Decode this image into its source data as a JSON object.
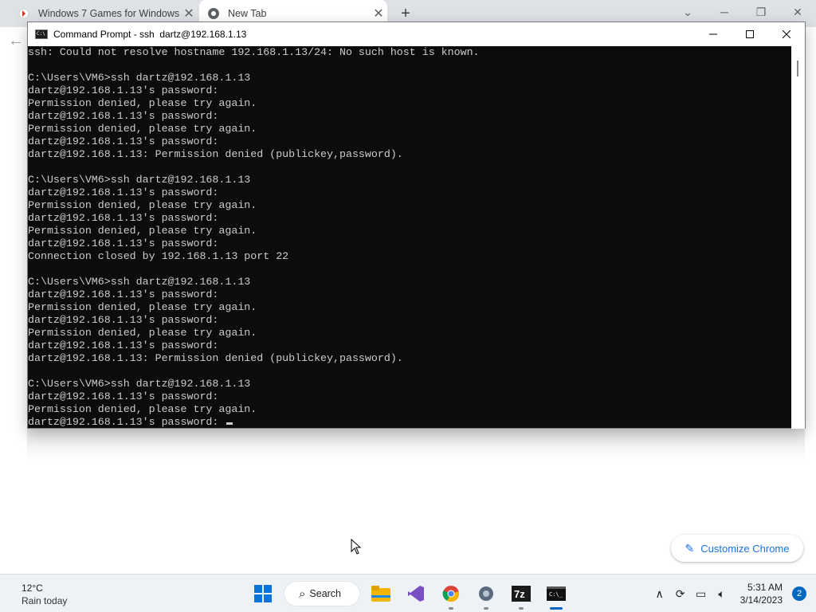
{
  "chrome": {
    "tabs": [
      {
        "title": "Windows 7 Games for Windows",
        "close": "✕",
        "favicon": "red-games-icon"
      },
      {
        "title": "New Tab",
        "close": "✕",
        "favicon": "chrome-icon"
      }
    ],
    "new_tab": "+",
    "customize_label": "Customize Chrome"
  },
  "cmd": {
    "title": "Command Prompt - ssh  dartz@192.168.1.13",
    "lines": [
      "ssh: Could not resolve hostname 192.168.1.13/24: No such host is known.",
      "",
      "C:\\Users\\VM6>ssh dartz@192.168.1.13",
      "dartz@192.168.1.13's password:",
      "Permission denied, please try again.",
      "dartz@192.168.1.13's password:",
      "Permission denied, please try again.",
      "dartz@192.168.1.13's password:",
      "dartz@192.168.1.13: Permission denied (publickey,password).",
      "",
      "C:\\Users\\VM6>ssh dartz@192.168.1.13",
      "dartz@192.168.1.13's password:",
      "Permission denied, please try again.",
      "dartz@192.168.1.13's password:",
      "Permission denied, please try again.",
      "dartz@192.168.1.13's password:",
      "Connection closed by 192.168.1.13 port 22",
      "",
      "C:\\Users\\VM6>ssh dartz@192.168.1.13",
      "dartz@192.168.1.13's password:",
      "Permission denied, please try again.",
      "dartz@192.168.1.13's password:",
      "Permission denied, please try again.",
      "dartz@192.168.1.13's password:",
      "dartz@192.168.1.13: Permission denied (publickey,password).",
      "",
      "C:\\Users\\VM6>ssh dartz@192.168.1.13",
      "dartz@192.168.1.13's password:",
      "Permission denied, please try again.",
      "dartz@192.168.1.13's password: "
    ]
  },
  "taskbar": {
    "weather_temp": "12°C",
    "weather_cond": "Rain today",
    "search_label": "Search",
    "apps": [
      "start-icon",
      "file-explorer-icon",
      "visual-studio-icon",
      "chrome-icon",
      "settings-icon",
      "7zip-icon",
      "terminal-icon"
    ],
    "clock_time": "5:31 AM",
    "clock_date": "3/14/2023",
    "notification_count": "2"
  },
  "colors": {
    "terminal_bg": "#0c0c0c",
    "terminal_fg": "#cccccc",
    "accent": "#0067c0",
    "chrome_link": "#1a73e8"
  }
}
